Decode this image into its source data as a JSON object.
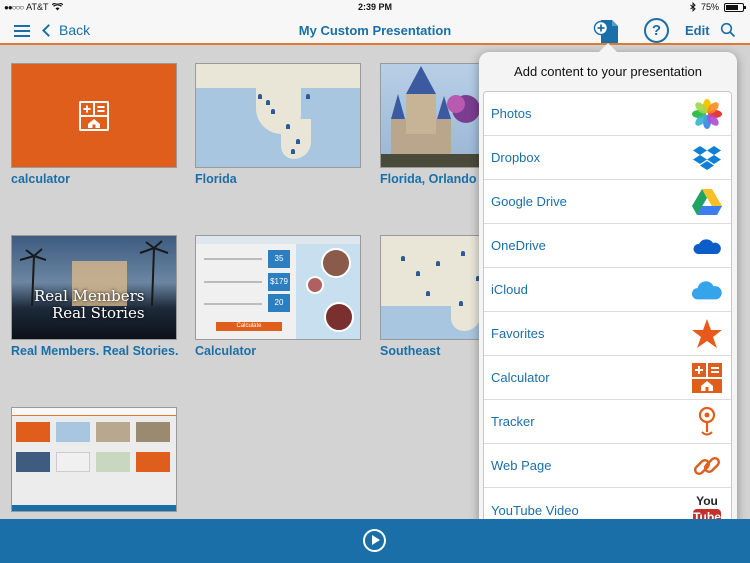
{
  "status_bar": {
    "carrier": "AT&T",
    "time": "2:39 PM",
    "battery": "75%",
    "battery_level": 0.75
  },
  "nav": {
    "back_label": "Back",
    "title": "My Custom Presentation",
    "edit_label": "Edit",
    "help_label": "?"
  },
  "tiles": [
    {
      "label": "calculator"
    },
    {
      "label": "Florida"
    },
    {
      "label": "Florida, Orlando"
    },
    {
      "label": "Real Members. Real Stories."
    },
    {
      "label": "Calculator"
    },
    {
      "label": "Southeast"
    },
    {
      "label": ""
    }
  ],
  "thumb_text": {
    "real_members": "Real Members",
    "real_stories": "Real Stories",
    "calc_values": [
      "35",
      "$179",
      "20"
    ],
    "calc_button": "Calculate"
  },
  "popover": {
    "title": "Add content to your presentation",
    "items": [
      {
        "label": "Photos",
        "icon": "photos-icon"
      },
      {
        "label": "Dropbox",
        "icon": "dropbox-icon"
      },
      {
        "label": "Google Drive",
        "icon": "google-drive-icon"
      },
      {
        "label": "OneDrive",
        "icon": "onedrive-icon"
      },
      {
        "label": "iCloud",
        "icon": "icloud-icon"
      },
      {
        "label": "Favorites",
        "icon": "star-icon"
      },
      {
        "label": "Calculator",
        "icon": "calculator-icon"
      },
      {
        "label": "Tracker",
        "icon": "tracker-icon"
      },
      {
        "label": "Web Page",
        "icon": "link-icon"
      },
      {
        "label": "YouTube Video",
        "icon": "youtube-icon"
      }
    ],
    "youtube_you": "You",
    "youtube_tube": "Tube"
  },
  "colors": {
    "accent": "#1a6fa8",
    "orange": "#e05e1c",
    "divider": "#e07a2e"
  }
}
